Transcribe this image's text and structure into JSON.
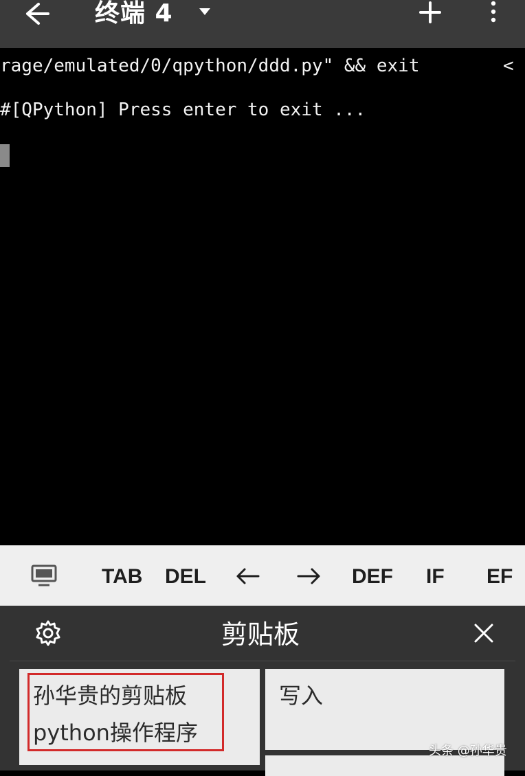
{
  "appbar": {
    "title": "终端 4",
    "icons": [
      "back-arrow-icon",
      "dropdown-caret-icon",
      "plus-icon",
      "more-vertical-icon"
    ]
  },
  "terminal": {
    "lines": [
      "rage/emulated/0/qpython/ddd.py\" && exit",
      "#[QPython] Press enter to exit ..."
    ],
    "overflow_marker": "<"
  },
  "extra_keys": {
    "keys": [
      "TAB",
      "DEL",
      "DEF",
      "IF",
      "EF"
    ],
    "icons": [
      "monitor-icon",
      "arrow-left-icon",
      "arrow-right-icon"
    ]
  },
  "clipboard": {
    "title": "剪贴板",
    "items": [
      {
        "lines": [
          "孙华贵的剪贴板",
          "python操作程序"
        ]
      },
      {
        "lines": [
          "写入"
        ]
      }
    ],
    "icons": [
      "gear-icon",
      "close-icon"
    ],
    "highlight_color": "#d22a2a"
  },
  "watermark": "头条 @孙华贵"
}
